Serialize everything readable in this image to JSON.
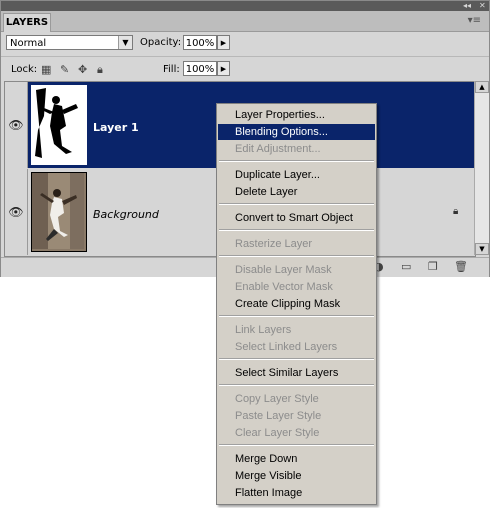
{
  "panel": {
    "tab_label": "LAYERS",
    "blend_mode": "Normal",
    "opacity_label": "Opacity:",
    "opacity_value": "100%",
    "lock_label": "Lock:",
    "fill_label": "Fill:",
    "fill_value": "100%"
  },
  "layers": [
    {
      "name": "Layer 1",
      "selected": true
    },
    {
      "name": "Background",
      "selected": false,
      "locked": true
    }
  ],
  "context_menu": {
    "items": [
      {
        "label": "Layer Properties...",
        "enabled": true
      },
      {
        "label": "Blending Options...",
        "enabled": true,
        "highlighted": true
      },
      {
        "label": "Edit Adjustment...",
        "enabled": false
      },
      {
        "label": "Duplicate Layer...",
        "enabled": true
      },
      {
        "label": "Delete Layer",
        "enabled": true
      },
      {
        "label": "Convert to Smart Object",
        "enabled": true
      },
      {
        "label": "Rasterize Layer",
        "enabled": false
      },
      {
        "label": "Disable Layer Mask",
        "enabled": false
      },
      {
        "label": "Enable Vector Mask",
        "enabled": false
      },
      {
        "label": "Create Clipping Mask",
        "enabled": true
      },
      {
        "label": "Link Layers",
        "enabled": false
      },
      {
        "label": "Select Linked Layers",
        "enabled": false
      },
      {
        "label": "Select Similar Layers",
        "enabled": true
      },
      {
        "label": "Copy Layer Style",
        "enabled": false
      },
      {
        "label": "Paste Layer Style",
        "enabled": false
      },
      {
        "label": "Clear Layer Style",
        "enabled": false
      },
      {
        "label": "Merge Down",
        "enabled": true
      },
      {
        "label": "Merge Visible",
        "enabled": true
      },
      {
        "label": "Flatten Image",
        "enabled": true
      }
    ]
  },
  "colors": {
    "selection": "#0a246a",
    "panel_bg": "#d6d6d6",
    "menu_bg": "#d4d0c8"
  }
}
